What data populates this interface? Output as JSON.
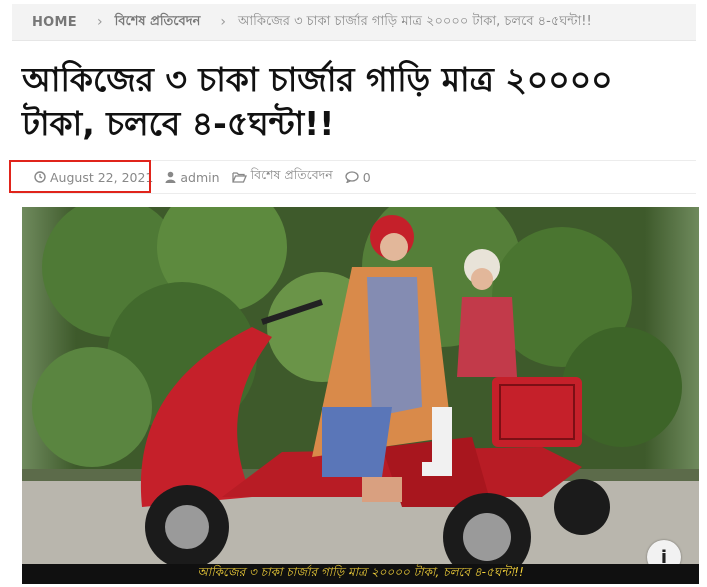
{
  "breadcrumb": {
    "home": "HOME",
    "category": "বিশেষ প্রতিবেদন",
    "current": "আকিজের ৩ চাকা চার্জার গাড়ি মাত্র ২০০০০ টাকা, চলবে ৪-৫ঘন্টা!!",
    "separator_icon": "chevron-right-icon"
  },
  "article": {
    "title": "আকিজের ৩ চাকা চার্জার গাড়ি মাত্র ২০০০০ টাকা, চলবে ৪-৫ঘন্টা!!",
    "meta": {
      "date": "August 22, 2021",
      "author": "admin",
      "category": "বিশেষ প্রতিবেদন",
      "comments": "0"
    },
    "image_caption": "আকিজের ৩ চাকা চার্জার গাড়ি মাত্র ২০০০০ টাকা, চলবে ৪-৫ঘন্টা!!",
    "corner_button": "i"
  },
  "colors": {
    "highlight_box": "#e0241b",
    "caption_text": "#f4d23a",
    "scooter_red": "#c5202a"
  }
}
